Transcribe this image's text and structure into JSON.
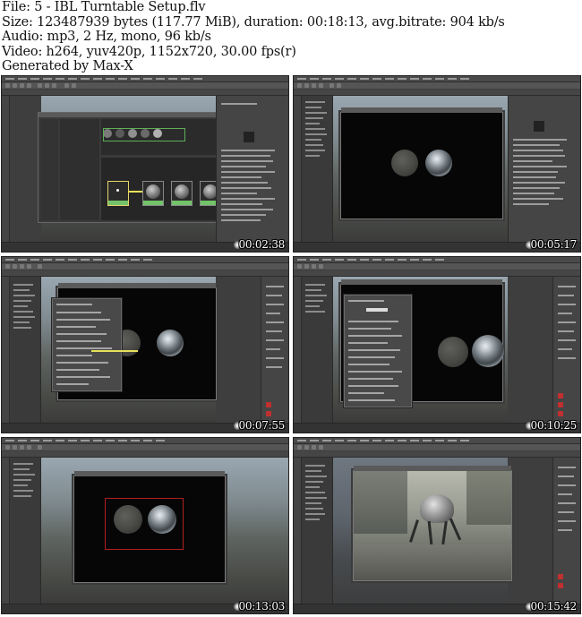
{
  "header": {
    "file": "File: 5 - IBL Turntable Setup.flv",
    "size": "Size: 123487939 bytes (117.77 MiB), duration: 00:18:13, avg.bitrate: 904 kb/s",
    "audio": "Audio: mp3, 2 Hz, mono, 96 kb/s",
    "video": "Video: h264, yuv420p, 1152x720, 30.00 fps(r)",
    "generator": "Generated by Max-X"
  },
  "thumbnails": [
    {
      "timestamp": "00:02:38",
      "scene": "hypershade"
    },
    {
      "timestamp": "00:05:17",
      "scene": "render-view"
    },
    {
      "timestamp": "00:07:55",
      "scene": "attribute-dialog"
    },
    {
      "timestamp": "00:10:25",
      "scene": "attribute-editor"
    },
    {
      "timestamp": "00:13:03",
      "scene": "viewport-spheres"
    },
    {
      "timestamp": "00:15:42",
      "scene": "creature-render"
    }
  ],
  "colors": {
    "timestamp_text": "#ffffff",
    "maya_ui": "#444444",
    "node_green": "#73c36a",
    "connection_yellow": "#e6e15a"
  }
}
